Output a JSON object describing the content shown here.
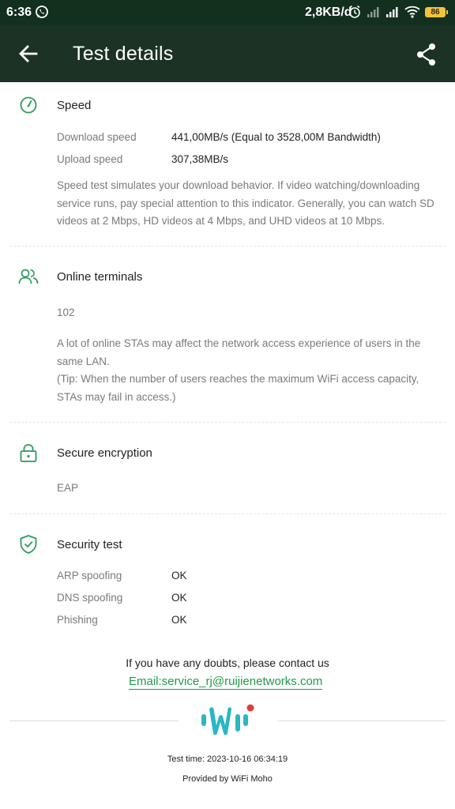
{
  "status_bar": {
    "time": "6:36",
    "net_speed": "2,8KB/d",
    "battery": "86"
  },
  "header": {
    "title": "Test details"
  },
  "speed": {
    "title": "Speed",
    "download_label": "Download speed",
    "download_value": "441,00MB/s (Equal to 3528,00M Bandwidth)",
    "upload_label": "Upload speed",
    "upload_value": "307,38MB/s",
    "description": "Speed test simulates your download behavior. If video watching/downloading service runs, pay special attention to this indicator. Generally, you can watch SD videos at 2 Mbps, HD videos at 4 Mbps, and UHD videos at 10 Mbps."
  },
  "terminals": {
    "title": "Online terminals",
    "count": "102",
    "description_1": "A lot of online STAs may affect the network access experience of users in the same LAN.",
    "description_2": "(Tip: When the number of users reaches the maximum WiFi access capacity, STAs may fail in access.)"
  },
  "encryption": {
    "title": "Secure encryption",
    "value": "EAP"
  },
  "security": {
    "title": "Security test",
    "items": [
      {
        "label": "ARP spoofing",
        "value": "OK"
      },
      {
        "label": "DNS spoofing",
        "value": "OK"
      },
      {
        "label": "Phishing",
        "value": "OK"
      }
    ]
  },
  "footer": {
    "contact_text": "If you have any doubts, please contact us",
    "email": "Email:service_rj@ruijienetworks.com",
    "test_time": "Test time: 2023-10-16 06:34:19",
    "provided_by": "Provided by WiFi Moho"
  },
  "icons": {
    "back": "arrow-left-icon",
    "share": "share-icon",
    "speed": "speedometer-icon",
    "terminals": "users-icon",
    "encryption": "lock-icon",
    "security": "shield-check-icon"
  },
  "colors": {
    "status_bar": "#13301f",
    "header": "#1c3224",
    "accent_green": "#2a9b5b",
    "link_green": "#1f9a4a",
    "logo_teal": "#2bb6c4",
    "logo_red": "#e23a3a",
    "battery": "#f4c33b"
  }
}
